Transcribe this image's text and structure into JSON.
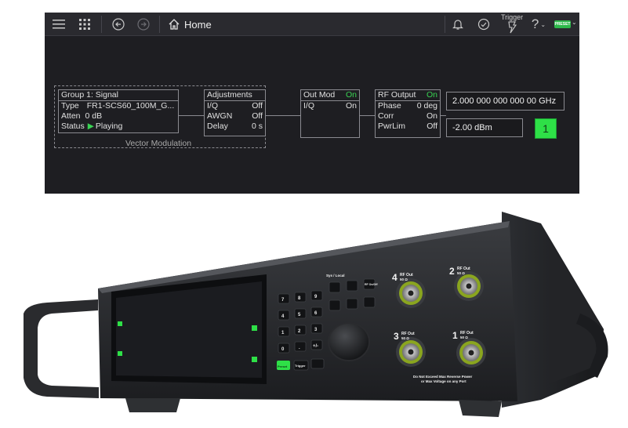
{
  "header": {
    "title": "Home",
    "trigger_label": "Trigger",
    "help_label": "?",
    "preset_label": "PRESET"
  },
  "group": {
    "title": "Group 1: Signal",
    "rows": [
      {
        "label": "Type",
        "value": "FR1-SCS60_100M_G..."
      },
      {
        "label": "Atten",
        "value": "0 dB"
      },
      {
        "label": "Status",
        "value": "Playing"
      }
    ],
    "vector_label": "Vector Modulation"
  },
  "adjustments": {
    "title": "Adjustments",
    "rows": [
      {
        "label": "I/Q",
        "value": "Off"
      },
      {
        "label": "AWGN",
        "value": "Off"
      },
      {
        "label": "Delay",
        "value": "0 s"
      }
    ]
  },
  "out_mod": {
    "title": "Out Mod",
    "status": "On",
    "rows": [
      {
        "label": "I/Q",
        "value": "On"
      }
    ]
  },
  "rf_output": {
    "title": "RF Output",
    "status": "On",
    "rows": [
      {
        "label": "Phase",
        "value": "0 deg"
      },
      {
        "label": "Corr",
        "value": "On"
      },
      {
        "label": "PwrLim",
        "value": "Off"
      }
    ]
  },
  "frequency": "2.000 000 000 000 00 GHz",
  "amplitude": "-2.00 dBm",
  "channel": "1",
  "instrument": {
    "nav_label": "Sys / Local",
    "ports": [
      {
        "number": "4",
        "label": "RF Out",
        "imp": "50 Ω"
      },
      {
        "number": "2",
        "label": "RF Out",
        "imp": "50 Ω"
      },
      {
        "number": "3",
        "label": "RF Out",
        "imp": "50 Ω"
      },
      {
        "number": "1",
        "label": "RF Out",
        "imp": "50 Ω"
      }
    ],
    "warning_line1": "Do Not Exceed Max Reverse Power",
    "warning_line2": "or Max Voltage on any Port",
    "keys": [
      "7",
      "8",
      "9",
      "4",
      "5",
      "6",
      "1",
      "2",
      "3",
      "0",
      ".",
      "+/-"
    ],
    "preset_key": "Preset",
    "trigger_key": "Trigger",
    "rf_onoff": "RF On/Off",
    "colors": {
      "accent_green": "#2ee047",
      "status_on": "#39d353"
    }
  }
}
